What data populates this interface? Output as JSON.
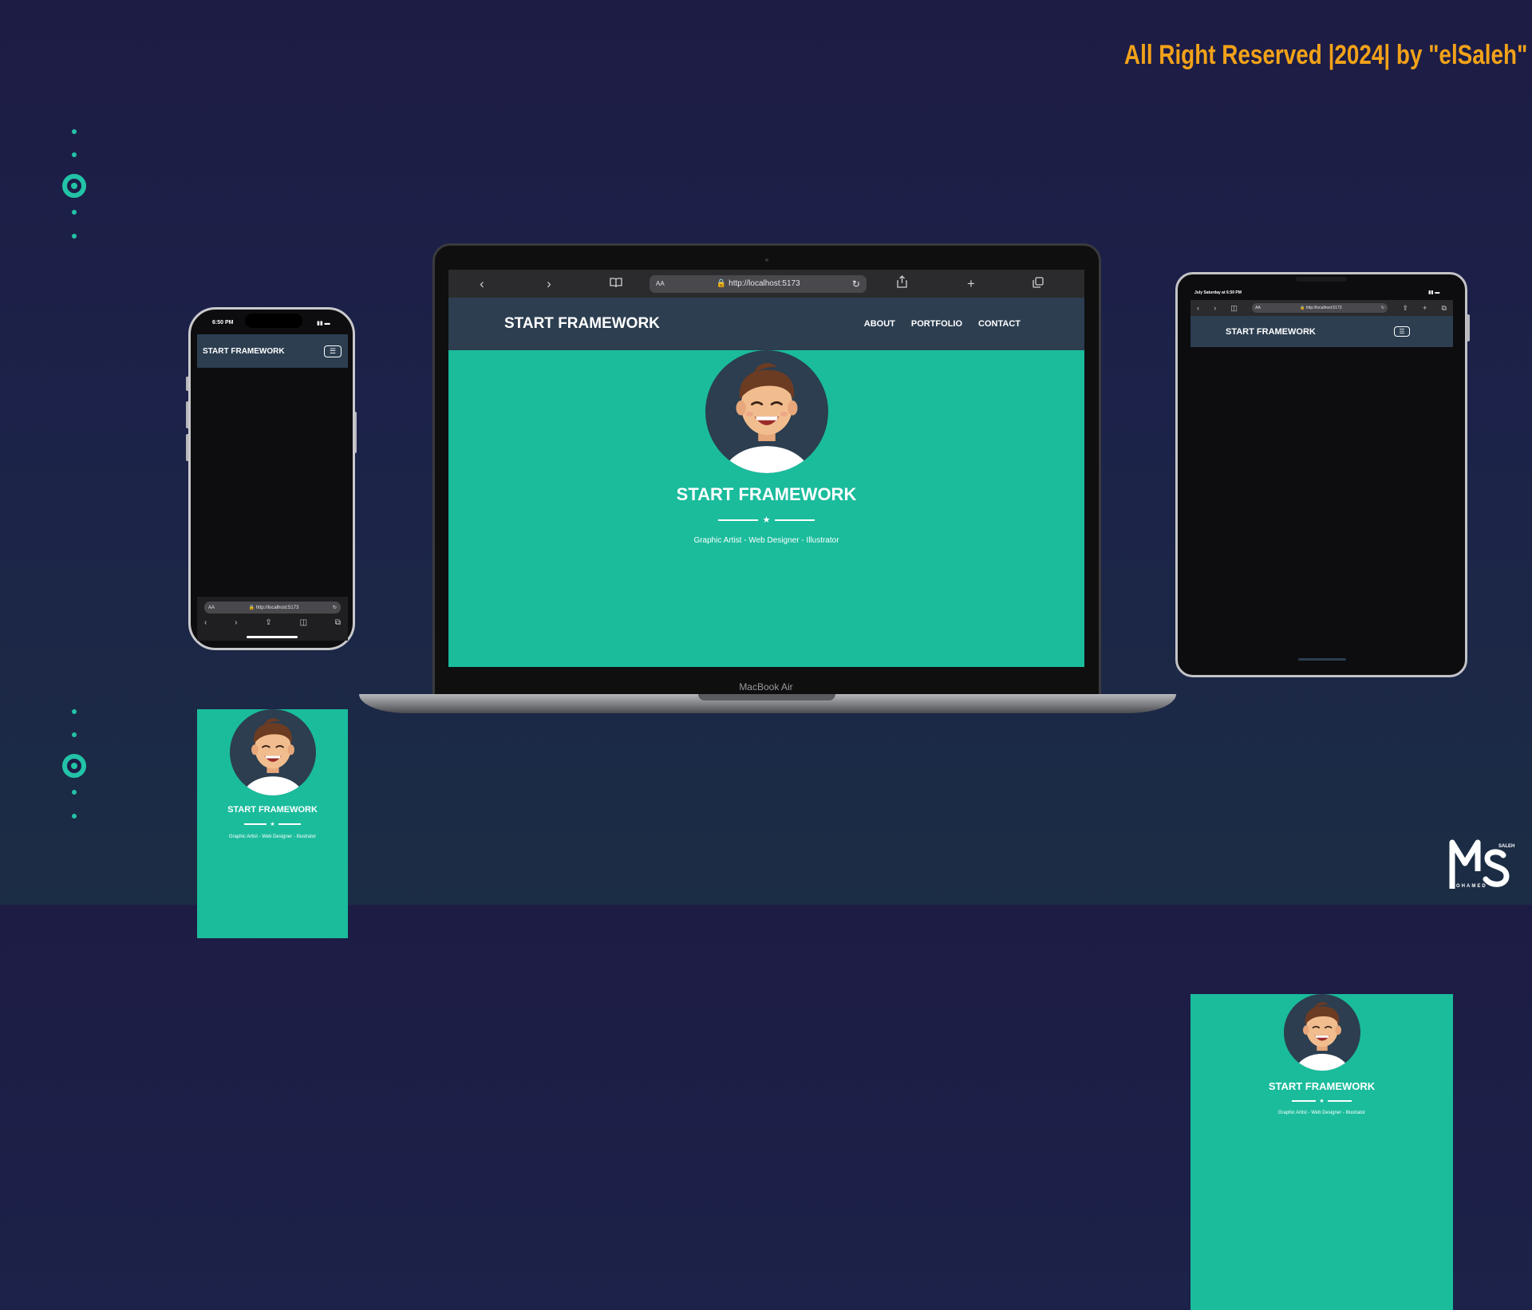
{
  "copyright": "All Right Reserved |2024| by \"elSaleh\"",
  "site": {
    "brand": "START FRAMEWORK",
    "nav": [
      "ABOUT",
      "PORTFOLIO",
      "CONTACT"
    ],
    "hero_title": "START FRAMEWORK",
    "hero_subtitle": "Graphic Artist - Web Designer - Illustrator",
    "divider_icon": "star-icon"
  },
  "browser": {
    "url": "http://localhost:5173",
    "text_size": "AA"
  },
  "phone": {
    "time": "6:50 PM",
    "url": "http://localhost:5173",
    "text_size": "AA"
  },
  "tablet": {
    "status": "July Saturday at 6:50 PM",
    "url": "http://localhost:5173",
    "text_size": "AA"
  },
  "laptop_model": "MacBook Air",
  "logo": {
    "letters": "MS",
    "top_word": "SALEH",
    "bottom_word": "MOHAMED"
  },
  "colors": {
    "background": "#1d1c45",
    "accent": "#22c3a6",
    "hero": "#1abc9c",
    "navbar": "#2c3e50",
    "copyright": "#f2a219"
  }
}
